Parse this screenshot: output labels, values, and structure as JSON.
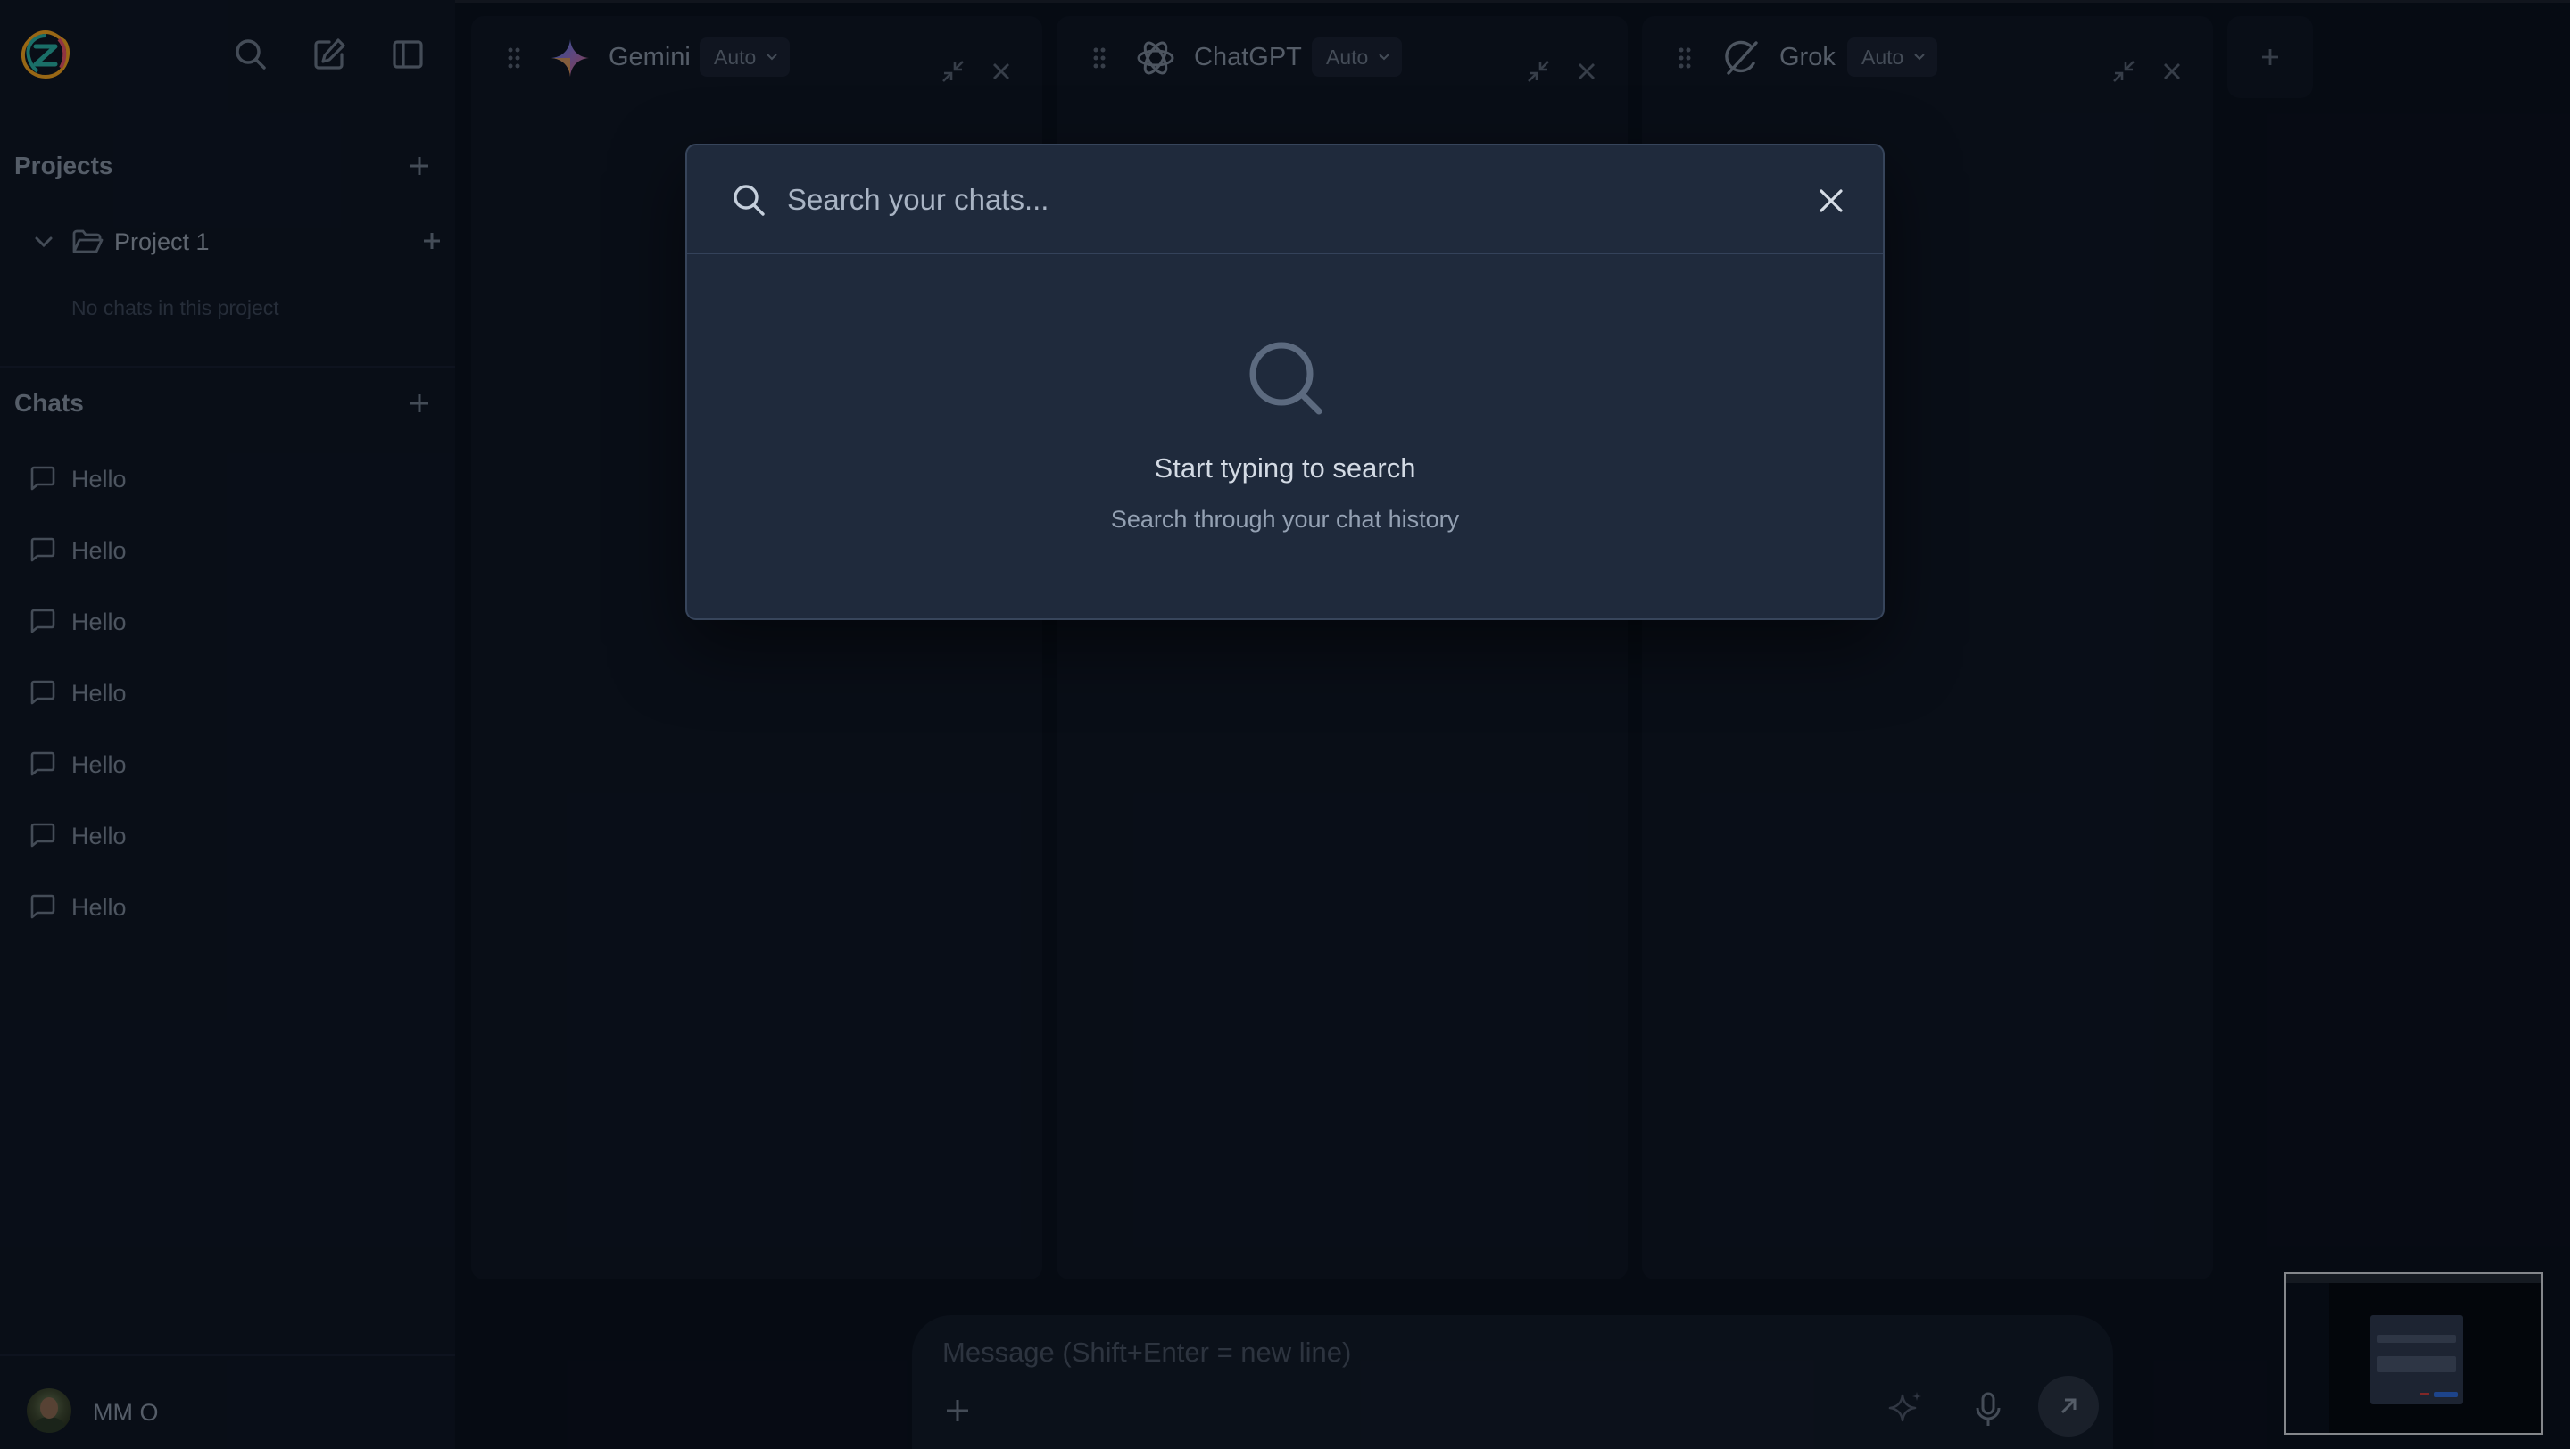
{
  "sidebar": {
    "projects_title": "Projects",
    "project": {
      "name": "Project 1",
      "empty_text": "No chats in this project"
    },
    "chats_title": "Chats",
    "chats": [
      {
        "label": "Hello"
      },
      {
        "label": "Hello"
      },
      {
        "label": "Hello"
      },
      {
        "label": "Hello"
      },
      {
        "label": "Hello"
      },
      {
        "label": "Hello"
      },
      {
        "label": "Hello"
      }
    ],
    "user": {
      "name": "MM O"
    }
  },
  "panels": [
    {
      "name": "Gemini",
      "mode": "Auto"
    },
    {
      "name": "ChatGPT",
      "mode": "Auto"
    },
    {
      "name": "Grok",
      "mode": "Auto"
    }
  ],
  "composer": {
    "placeholder": "Message (Shift+Enter = new line)"
  },
  "search_modal": {
    "placeholder": "Search your chats...",
    "empty_title": "Start typing to search",
    "empty_subtitle": "Search through your chat history"
  },
  "colors": {
    "background": "#0b1220",
    "sidebar": "#0f1726",
    "modal": "#1f2a3c",
    "gemini_blue": "#4285f4",
    "logo_orange": "#f5a623",
    "logo_teal": "#2bb3a8"
  }
}
